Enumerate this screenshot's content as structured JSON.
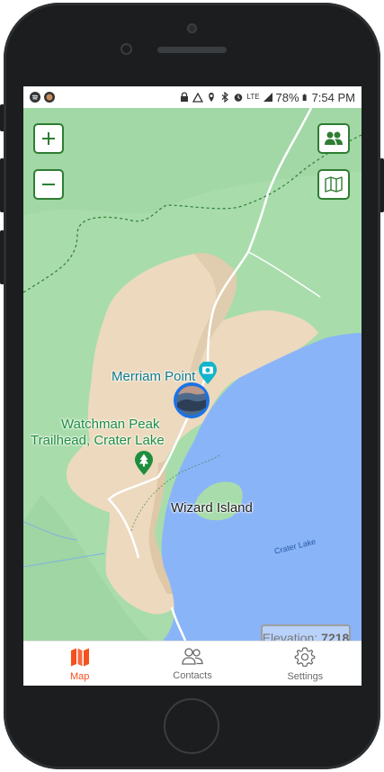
{
  "status": {
    "battery": "78%",
    "time": "7:54 PM",
    "network": "LTE"
  },
  "map": {
    "labels": {
      "merriam_point": "Merriam Point",
      "watchman_1": "Watchman Peak",
      "watchman_2": "Trailhead, Crater Lake",
      "wizard_island": "Wizard Island",
      "crater_lake": "Crater Lake"
    },
    "elevation": {
      "label": "Elevation:",
      "value": "7218"
    },
    "colors": {
      "forest": "#a8dcab",
      "rock": "#ecd9be",
      "water": "#8ab4f8",
      "trail": "#1e8e3e",
      "accent": "#2e7d32"
    }
  },
  "controls": {
    "zoom_in": "+",
    "zoom_out": "−"
  },
  "tabs": [
    {
      "label": "Map",
      "icon": "map-icon"
    },
    {
      "label": "Contacts",
      "icon": "contacts-icon"
    },
    {
      "label": "Settings",
      "icon": "gear-icon"
    }
  ]
}
